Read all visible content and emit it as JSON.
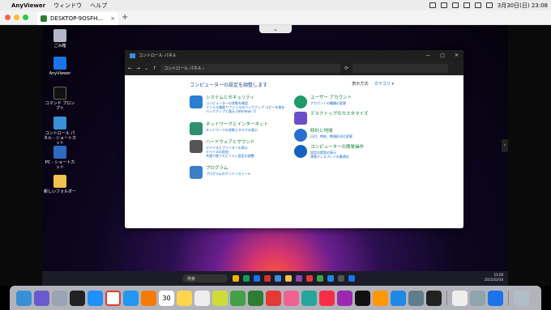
{
  "menubar": {
    "app_name": "AnyViewer",
    "menus": [
      "ウィンドウ",
      "ヘルプ"
    ],
    "clock": "3月30日(日) 23:08"
  },
  "window": {
    "tab_title": "DESKTOP-9OSFH...",
    "tab_close": "×",
    "new_tab": "+",
    "collapse": "⌄"
  },
  "desktop_icons": [
    {
      "label": "ごみ箱",
      "color": "#b0b8c8"
    },
    {
      "label": "AnyViewer",
      "color": "#1a73e8"
    },
    {
      "label": "コマンド プロンプト",
      "color": "#111111"
    },
    {
      "label": "コントロール パネル - ショートカット",
      "color": "#3a8fd8"
    },
    {
      "label": "PC - ショートカット",
      "color": "#2d6cc0"
    },
    {
      "label": "新しいフォルダー",
      "color": "#f2c14e"
    }
  ],
  "control_panel": {
    "title": "コントロール パネル",
    "address": "コントロール パネル  ›",
    "heading": "コンピューターの設定を調整します",
    "view_by_label": "表示方法:",
    "view_by_value": "カテゴリ ▾",
    "categories_left": [
      {
        "title": "システムとセキュリティ",
        "subs": [
          "コンピューターの状態を確認",
          "ファイル履歴でファイルのバックアップ コピーを保存",
          "バックアップと復元 (Windows 7)"
        ],
        "color": "#2a7fd4"
      },
      {
        "title": "ネットワークとインターネット",
        "subs": [
          "ネットワークの状態とタスクの表示"
        ],
        "color": "#2f8f6f"
      },
      {
        "title": "ハードウェアとサウンド",
        "subs": [
          "デバイスとプリンターの表示",
          "デバイスの追加",
          "共通で使うモビリティ設定の調整"
        ],
        "color": "#555555"
      },
      {
        "title": "プログラム",
        "subs": [
          "プログラムのアンインストール"
        ],
        "color": "#3a7fc8"
      }
    ],
    "categories_right": [
      {
        "title": "ユーザー アカウント",
        "subs": [
          "アカウントの種類の変更"
        ],
        "color": "#1f9a6a"
      },
      {
        "title": "デスクトップのカスタマイズ",
        "subs": [],
        "color": "#6a4fc8"
      },
      {
        "title": "時計と地域",
        "subs": [
          "日付、時刻、数値形式の変更"
        ],
        "color": "#2a6fd0"
      },
      {
        "title": "コンピューターの簡単操作",
        "subs": [
          "設定の提案の表示",
          "視覚ディスプレイの最適化"
        ],
        "color": "#1560c0"
      }
    ]
  },
  "taskbar": {
    "search": "検索",
    "tray_time": "23:08",
    "tray_date": "2025/03/30"
  }
}
